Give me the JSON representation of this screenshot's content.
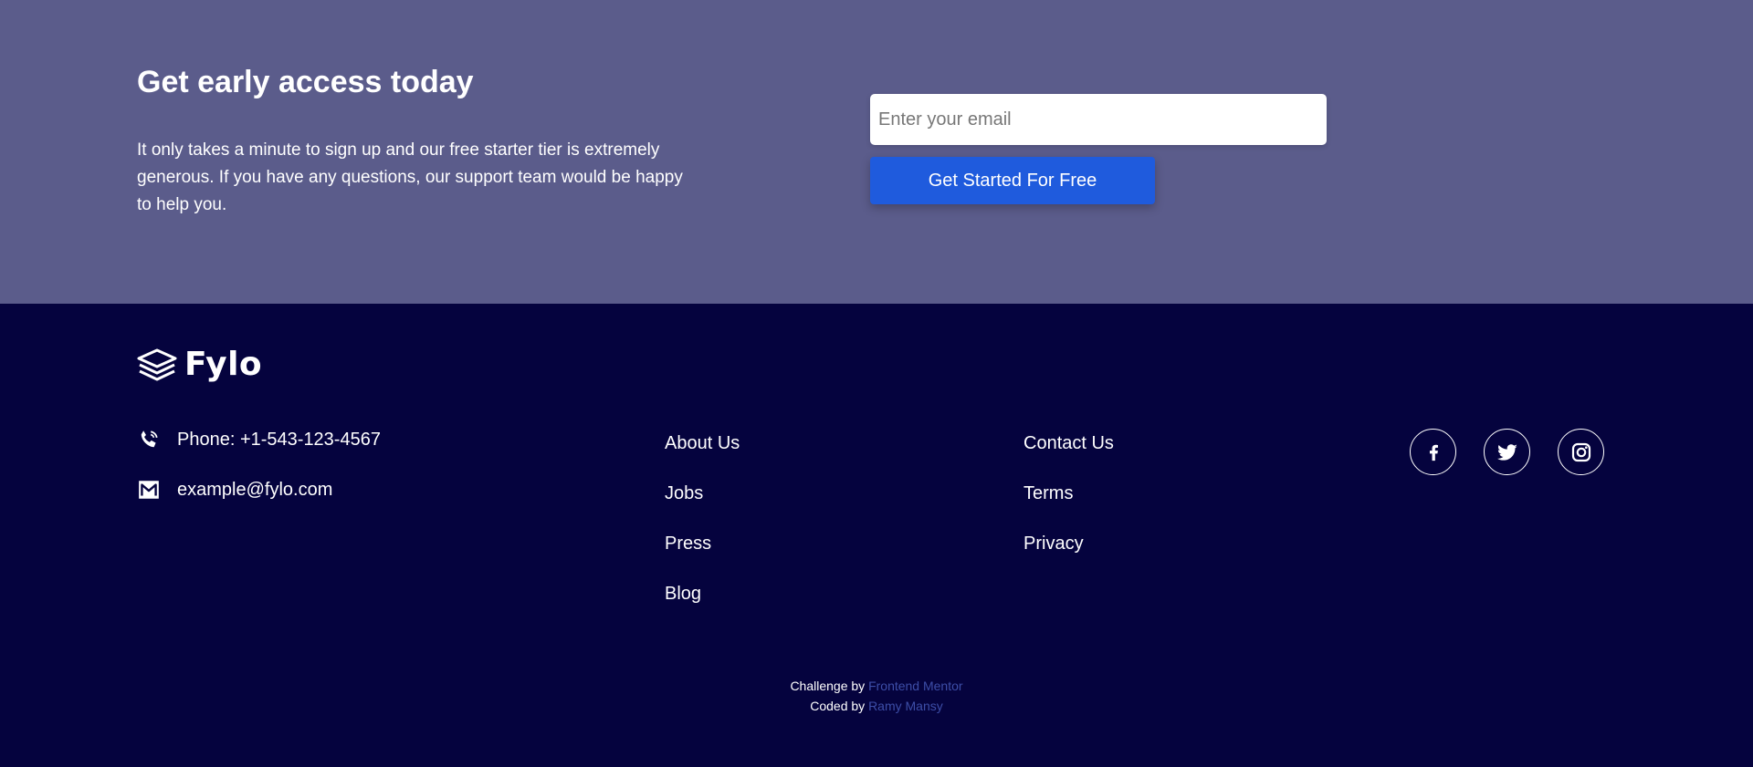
{
  "cta": {
    "title": "Get early access today",
    "text": "It only takes a minute to sign up and our free starter tier is extremely generous. If you have any questions, our support team would be happy to help you.",
    "email_placeholder": "Enter your email",
    "button_label": "Get Started For Free"
  },
  "footer": {
    "logo_text": "Fylo",
    "phone": "Phone: +1-543-123-4567",
    "email": "example@fylo.com",
    "links_col1": [
      "About Us",
      "Jobs",
      "Press",
      "Blog"
    ],
    "links_col2": [
      "Contact Us",
      "Terms",
      "Privacy"
    ],
    "social": [
      "facebook-icon",
      "twitter-icon",
      "instagram-icon"
    ],
    "attribution": {
      "challenge_prefix": "Challenge by",
      "challenge_link": "Frontend Mentor",
      "coded_prefix": "Coded by",
      "coded_link": "Ramy Mansy"
    }
  },
  "colors": {
    "cta_bg": "#5b5c8b",
    "footer_bg": "#05033e",
    "button_bg": "#1f5bdd",
    "attribution_link": "#3d4ea8"
  }
}
